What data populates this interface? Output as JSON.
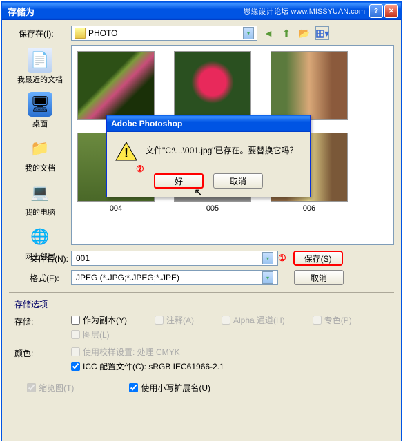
{
  "window": {
    "title": "存储为",
    "watermark_right": "思缘设计论坛  www.MISSYUAN.com"
  },
  "lookin": {
    "label": "保存在(I):",
    "value": "PHOTO"
  },
  "sidebar": {
    "items": [
      {
        "icon": "📄",
        "label": "我最近的文档"
      },
      {
        "icon": "🖥",
        "label": "桌面"
      },
      {
        "icon": "📁",
        "label": "我的文档"
      },
      {
        "icon": "💻",
        "label": "我的电脑"
      },
      {
        "icon": "🌐",
        "label": "网上邻居"
      }
    ]
  },
  "thumbs": {
    "labels": [
      "004",
      "005",
      "006"
    ]
  },
  "filename": {
    "label": "文件名(N):",
    "value": "001"
  },
  "format": {
    "label": "格式(F):",
    "value": "JPEG (*.JPG;*.JPEG;*.JPE)"
  },
  "buttons": {
    "save": "保存(S)",
    "cancel": "取消"
  },
  "markers": {
    "one": "①",
    "two": "②"
  },
  "options": {
    "title": "存储选项",
    "store_label": "存储:",
    "as_copy": "作为副本(Y)",
    "annotations": "注释(A)",
    "alpha": "Alpha 通道(H)",
    "spot": "专色(P)",
    "layers": "图层(L)",
    "color_label": "颜色:",
    "proof": "使用校样设置: 处理 CMYK",
    "icc": "ICC 配置文件(C): sRGB IEC61966-2.1",
    "thumbnail": "缩览图(T)",
    "lowercase": "使用小写扩展名(U)"
  },
  "dialog": {
    "title": "Adobe Photoshop",
    "message": "文件\"C:\\...\\001.jpg\"已存在。要替换它吗？",
    "ok": "好",
    "cancel": "取消"
  }
}
